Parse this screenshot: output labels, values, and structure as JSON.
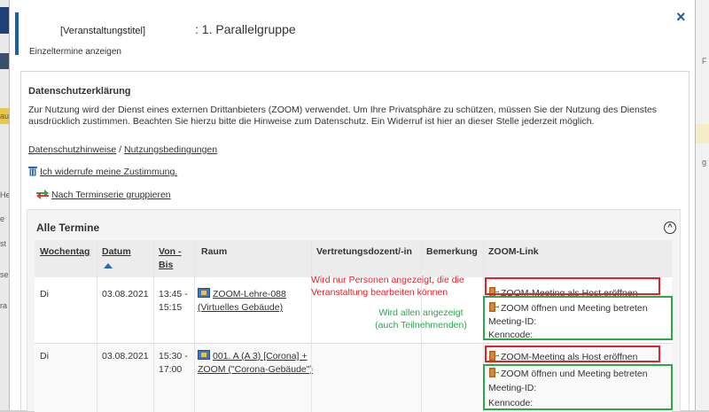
{
  "background": {
    "left_fragments": [
      "ausb",
      "He",
      "e",
      "st",
      "se",
      "ra"
    ],
    "right_fragments": [
      "F",
      "g"
    ]
  },
  "dialog": {
    "title_prefix": "[Veranstaltungstitel]",
    "title_suffix": ": 1. Parallelgruppe",
    "subtitle": "Einzeltermine anzeigen",
    "close_label": "×"
  },
  "privacy": {
    "heading": "Datenschutzerklärung",
    "text": "Zur Nutzung wird der Dienst eines externen Drittanbieters (ZOOM) verwendet. Um Ihre Privatsphäre zu schützen, müssen Sie der Nutzung des Dienstes ausdrücklich zustimmen. Beachten Sie hierzu bitte die Hinweise zum Datenschutz. Ein Widerruf ist hier an dieser Stelle jederzeit möglich.",
    "link_privacy": "Datenschutzhinweise",
    "separator": "/",
    "link_terms": "Nutzungsbedingungen",
    "revoke_label": "Ich widerrufe meine Zustimmung."
  },
  "group_link_label": "Nach Terminserie gruppieren",
  "termine": {
    "title": "Alle Termine",
    "headers": {
      "weekday": "Wochentag",
      "date": "Datum",
      "time": "Von - Bis",
      "room": "Raum",
      "substitute": "Vertretungsdozent/-in",
      "remark": "Bemerkung",
      "zoom": "ZOOM-Link"
    },
    "rows": [
      {
        "weekday": "Di",
        "date": "03.08.2021",
        "time": "13:45 - 15:15",
        "room": "ZOOM-Lehre-088 (Virtuelles Gebäude)",
        "host_label": "ZOOM-Meeting als Host eröffnen",
        "join_label": "ZOOM öffnen und Meeting betreten",
        "meeting_id_label": "Meeting-ID:",
        "passcode_label": "Kenncode:"
      },
      {
        "weekday": "Di",
        "date": "03.08.2021",
        "time": "15:30 - 17:00",
        "room": "001. A (A 3) [Corona] + ZOOM (\"Corona-Gebäude\")",
        "host_label": "ZOOM-Meeting als Host eröffnen",
        "join_label": "ZOOM öffnen und Meeting betreten",
        "meeting_id_label": "Meeting-ID:",
        "passcode_label": "Kenncode:"
      }
    ]
  },
  "annotations": {
    "red_note": "Wird nur Personen angezeigt, die die Veranstaltung bearbeiten können",
    "green_note": "Wird allen angezeigt (auch Teilnehmenden)",
    "red_color": "#e5202a",
    "green_color": "#2aa84a"
  },
  "colors": {
    "accent": "#1a5fa8",
    "header_bg": "#ececec"
  }
}
